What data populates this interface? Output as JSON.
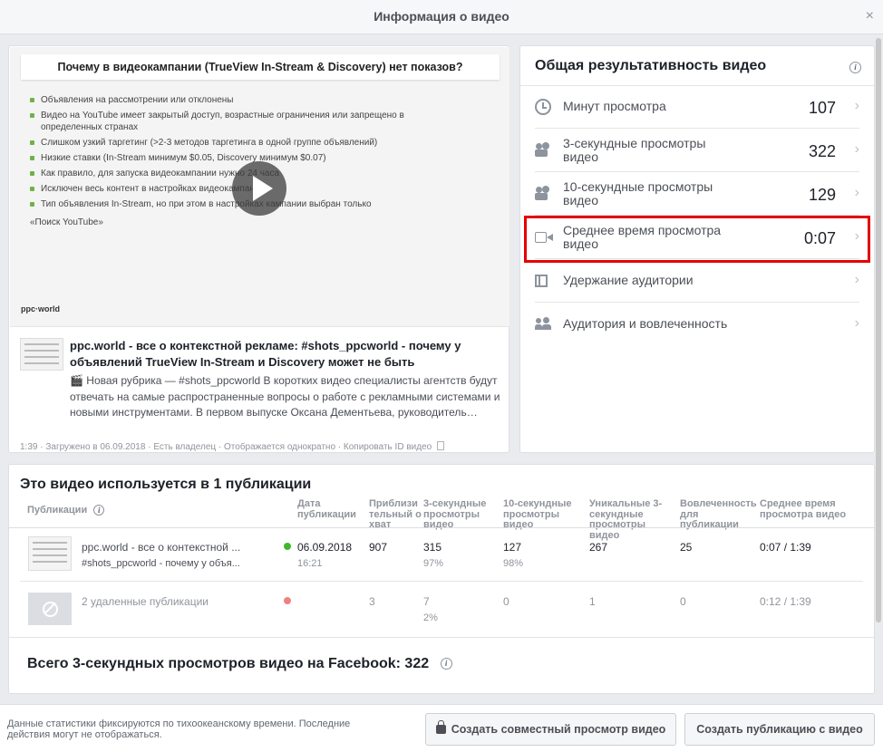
{
  "dialog": {
    "title": "Информация о видео",
    "close_glyph": "×"
  },
  "video": {
    "slide": {
      "title": "Почему в видеокампании (TrueView In-Stream & Discovery) нет показов?",
      "bullets": [
        "Объявления на рассмотрении или отклонены",
        "Видео на YouTube имеет закрытый доступ, возрастные ограничения или запрещено в определенных странах",
        "Слишком узкий таргетинг (>2-3 методов таргетинга в одной группе объявлений)",
        "Низкие ставки (In-Stream минимум $0.05, Discovery минимум $0.07)",
        "Как правило, для запуска видеокампании нужно 24 часа",
        "Исключен весь контент в настройках видеокампании",
        "Тип объявления In-Stream, но при этом в настройках кампании выбран только"
      ],
      "tail": "«Поиск YouTube»",
      "logo": "ppc·world"
    },
    "post_title": "ppc.world - все о контекстной рекламе: #shots_ppcworld - почему у объявлений TrueView In-Stream и Discovery может не быть",
    "post_desc": "🎬 Новая рубрика — #shots_ppcworld В коротких видео специалисты агентств будут отвечать на самые распространенные вопросы о работе с рекламными системами и новыми инструментами. В первом выпуске Оксана Дементьева, руководитель…",
    "meta": {
      "duration": "1:39",
      "uploaded": "Загружено в 06.09.2018",
      "owner": "Есть владелец",
      "display": "Отображается однократно",
      "copy_id": "Копировать ID видео"
    }
  },
  "performance": {
    "title": "Общая результативность видео",
    "metrics": [
      {
        "label": "Минут просмотра",
        "value": "107",
        "icon": "clock-icon"
      },
      {
        "label": "3-секундные просмотры видео",
        "value": "322",
        "icon": "video-camera-icon"
      },
      {
        "label": "10-секундные просмотры видео",
        "value": "129",
        "icon": "video-camera-icon"
      },
      {
        "label": "Среднее время просмотра видео",
        "value": "0:07",
        "icon": "video-icon"
      },
      {
        "label": "Удержание аудитории",
        "value": "",
        "icon": "film-icon"
      },
      {
        "label": "Аудитория и вовлеченность",
        "value": "",
        "icon": "people-icon"
      }
    ]
  },
  "publications": {
    "title": "Это видео используется в 1 публикации",
    "headers": {
      "pub": "Публикации",
      "date": "Дата публикации",
      "reach": "Приблизительный охват",
      "v3": "3-секундные просмотры видео",
      "v10": "10-секундные просмотры видео",
      "unique3": "Уникальные 3-секундные просмотры видео",
      "engagement": "Вовлеченность для публикации",
      "avg": "Среднее время просмотра видео"
    },
    "rows": [
      {
        "name": "ppc.world - все о контекстной ...",
        "subname": "#shots_ppcworld - почему у объя...",
        "date": "06.09.2018",
        "time": "16:21",
        "reach": "907",
        "v3": "315",
        "v3_pct": "97%",
        "v10": "127",
        "v10_pct": "98%",
        "unique3": "267",
        "engagement": "25",
        "avg": "0:07 / 1:39",
        "status_color": "#42b72a"
      },
      {
        "name": "2 удаленные публикации",
        "reach": "3",
        "v3": "7",
        "v3_pct": "2%",
        "v10": "0",
        "unique3": "1",
        "engagement": "0",
        "avg": "0:12 / 1:39",
        "status_color": "#f08080"
      }
    ],
    "total": "Всего 3-секундных просмотров видео на Facebook: 322"
  },
  "footer": {
    "note": "Данные статистики фиксируются по тихоокеанскому времени. Последние действия могут не отображаться.",
    "watch_button": "Создать совместный просмотр видео",
    "create_button": "Создать публикацию с видео"
  },
  "colors": {
    "highlight": "#e40000",
    "accent": "#4b4f56"
  }
}
